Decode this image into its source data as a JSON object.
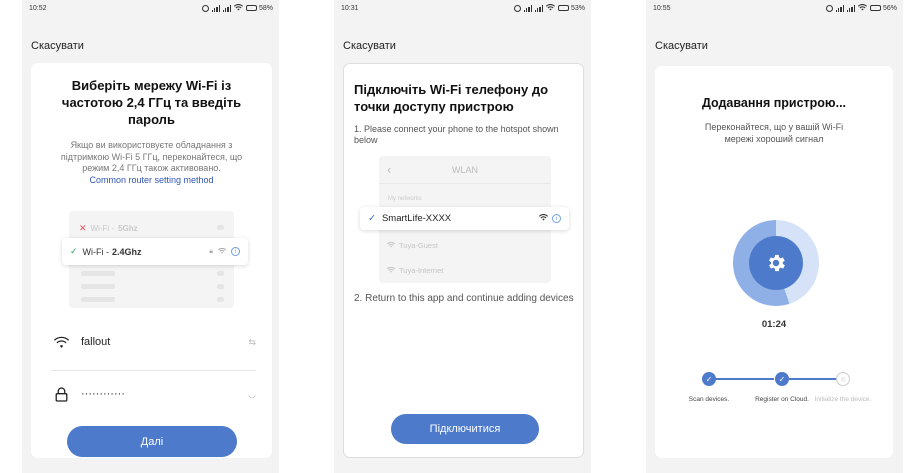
{
  "screens": [
    {
      "status_time": "10:52",
      "battery": "58%",
      "cancel": "Скасувати",
      "title": "Виберіть мережу Wi-Fi із частотою 2,4 ГГц та введіть пароль",
      "description": "Якщо ви використовуєте обладнання з підтримкою Wi-Fi 5 ГГц, переконайтеся, що режим 2,4 ГГц також активовано.",
      "link": "Common router setting method",
      "illustration": {
        "row_5g_prefix": "Wi-Fi - ",
        "row_5g_band": "5Ghz",
        "row_24_prefix": "Wi-Fi - ",
        "row_24_band": "2.4Ghz"
      },
      "wifi_name": "fallout",
      "password_mask": "············",
      "next_button": "Далі"
    },
    {
      "status_time": "10:31",
      "battery": "53%",
      "cancel": "Скасувати",
      "title": "Підключіть Wi-Fi телефону до точки доступу пристрою",
      "step1": "1. Please connect your phone to the hotspot shown below",
      "wlan": {
        "header": "WLAN",
        "section": "My networks",
        "selected": "SmartLife-XXXX",
        "other1": "Tuya-Guest",
        "other2": "Tuya-Internet"
      },
      "step2": "2. Return to this app and continue adding devices",
      "connect_button": "Підключитися"
    },
    {
      "status_time": "10:55",
      "battery": "56%",
      "cancel": "Скасувати",
      "title": "Додавання пристрою...",
      "description": "Переконайтеся, що у вашій Wi-Fi мережі хороший сигнал",
      "progress_fraction": 0.55,
      "timer": "01:24",
      "steps": [
        {
          "label": "Scan devices.",
          "done": true
        },
        {
          "label": "Register on Cloud.",
          "done": true
        },
        {
          "label": "Initialize the device.",
          "done": false
        }
      ]
    }
  ],
  "colors": {
    "accent": "#4d7acb",
    "link": "#2f55b3",
    "check_green": "#2fa86a"
  }
}
